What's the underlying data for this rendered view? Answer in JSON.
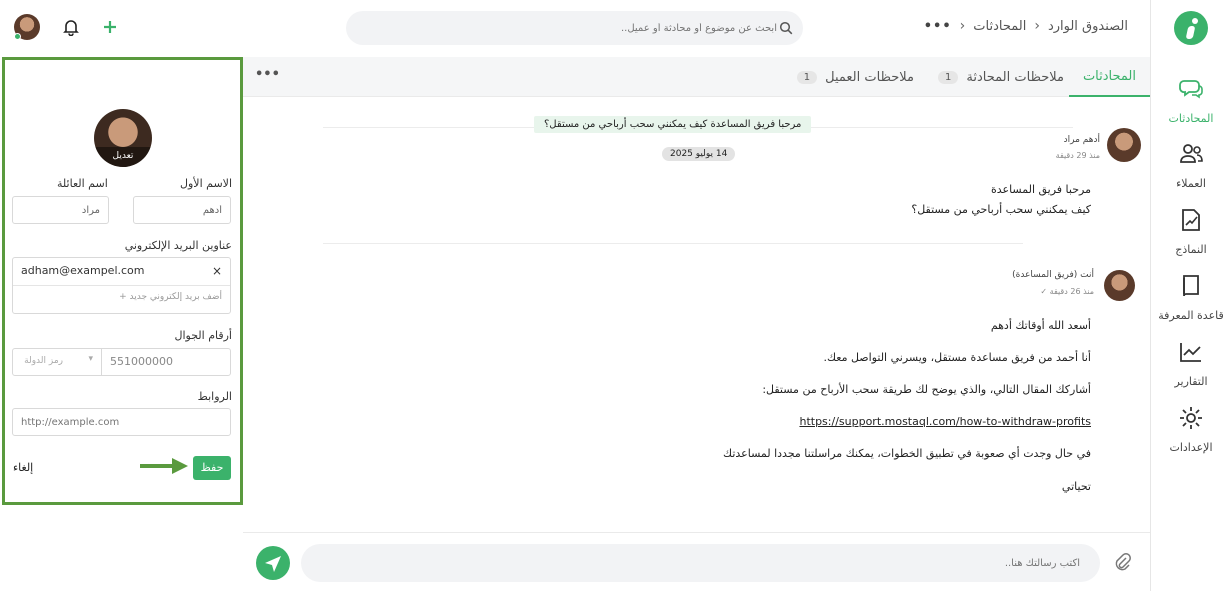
{
  "nav": {
    "items": [
      {
        "label": "المحادثات",
        "icon": "chat-icon",
        "active": true
      },
      {
        "label": "العملاء",
        "icon": "users-icon"
      },
      {
        "label": "النماذج",
        "icon": "templates-icon"
      },
      {
        "label": "قاعدة المعرفة",
        "icon": "book-icon"
      },
      {
        "label": "التقارير",
        "icon": "reports-icon"
      },
      {
        "label": "الإعدادات",
        "icon": "gear-icon"
      }
    ]
  },
  "breadcrumb": {
    "root": "الصندوق الوارد",
    "current": "المحادثات",
    "more": "•••"
  },
  "search": {
    "placeholder": "ابحث عن موضوع أو محادثة أو عميل.."
  },
  "tabs": [
    {
      "label": "المحادثات",
      "active": true
    },
    {
      "label": "ملاحظات المحادثة",
      "count": "1"
    },
    {
      "label": "ملاحظات العميل",
      "count": "1"
    }
  ],
  "tabs_more": "•••",
  "profile": {
    "edit_label": "تعديل",
    "first_name_label": "الاسم الأول",
    "first_name_value": "أدهم",
    "last_name_label": "اسم العائلة",
    "last_name_value": "مراد",
    "emails_label": "عناوين البريد الإلكتروني",
    "email_value": "adham@exampel.com",
    "email_remove": "×",
    "add_email": "أضف بريد إلكتروني جديد",
    "phones_label": "أرقام الجوال",
    "country_code_placeholder": "رمز الدولة",
    "phone_value": "551000000",
    "links_label": "الروابط",
    "link_placeholder": "http://example.com",
    "save_label": "حفظ",
    "cancel_label": "إلغاء"
  },
  "conversation": {
    "subject": "مرحبا فريق المساعدة كيف يمكنني سحب أرباحي من مستقل؟",
    "date": "14 يوليو 2025",
    "messages": [
      {
        "sender": "أدهم مراد",
        "time": "منذ 29 دقيقة",
        "lines": [
          "مرحبا فريق المساعدة",
          "كيف يمكنني سحب أرباحي من مستقل؟"
        ]
      },
      {
        "sender": "أنت (فريق المساعدة)",
        "time": "منذ 26 دقيقة ✓",
        "lines": [
          "أسعد الله أوقاتك أدهم",
          "أنا أحمد من فريق مساعدة مستقل، ويسرني التواصل معك.",
          "أشاركك المقال التالي، والذي يوضح لك طريقة سحب الأرباح من مستقل:",
          "https://support.mostaql.com/how-to-withdraw-profits",
          "في حال وجدت أي صعوبة في تطبيق الخطوات، يمكنك مراسلتنا مجددا لمساعدتك",
          "تحياتي"
        ]
      }
    ]
  },
  "composer": {
    "placeholder": "اكتب رسالتك هنا.."
  },
  "colors": {
    "accent": "#3bb26b",
    "highlight_border": "#5a9a3e"
  }
}
